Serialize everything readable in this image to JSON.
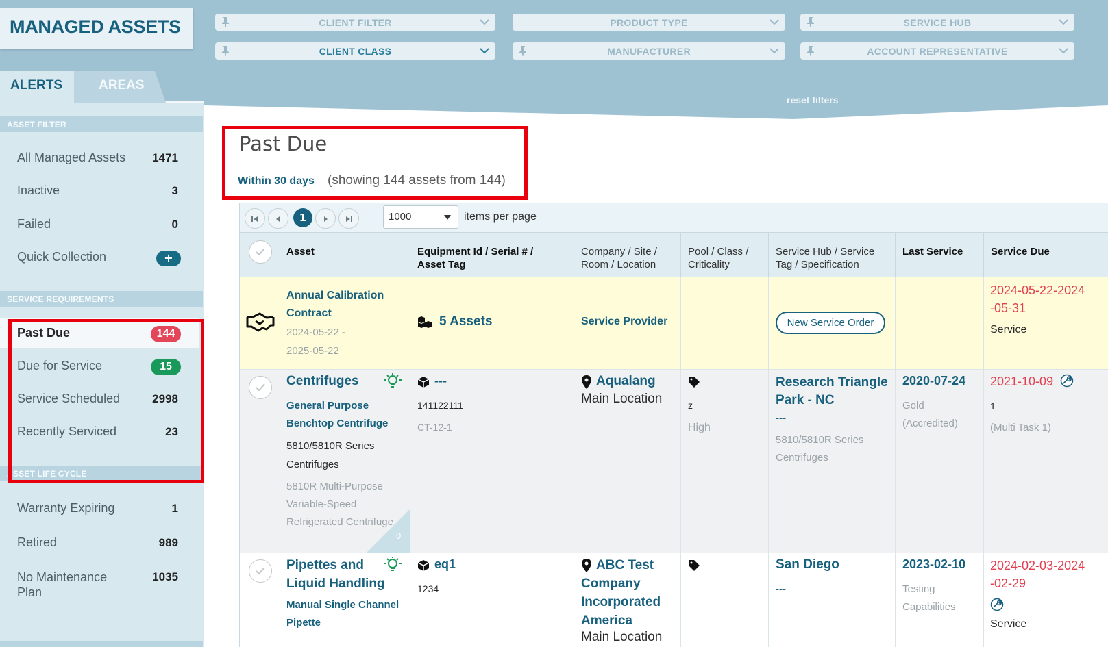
{
  "app": {
    "title": "MANAGED ASSETS"
  },
  "filters": [
    {
      "label": "CLIENT FILTER",
      "active": false
    },
    {
      "label": "PRODUCT TYPE",
      "active": false
    },
    {
      "label": "SERVICE HUB",
      "active": false
    },
    {
      "label": "CLIENT CLASS",
      "active": true
    },
    {
      "label": "MANUFACTURER",
      "active": false
    },
    {
      "label": "ACCOUNT REPRESENTATIVE",
      "active": false
    }
  ],
  "tabs": {
    "alerts": "ALERTS",
    "areas": "AREAS"
  },
  "reset_filters": "reset filters",
  "sidebar": {
    "asset_filter": {
      "heading": "ASSET FILTER",
      "items": [
        {
          "label": "All Managed Assets",
          "count": "1471"
        },
        {
          "label": "Inactive",
          "count": "3"
        },
        {
          "label": "Failed",
          "count": "0"
        },
        {
          "label": "Quick Collection",
          "count": "+"
        }
      ]
    },
    "service_requirements": {
      "heading": "SERVICE REQUIREMENTS",
      "items": [
        {
          "label": "Past Due",
          "count": "144"
        },
        {
          "label": "Due for Service",
          "count": "15"
        },
        {
          "label": "Service Scheduled",
          "count": "2998"
        },
        {
          "label": "Recently Serviced",
          "count": "23"
        }
      ]
    },
    "asset_life_cycle": {
      "heading": "ASSET LIFE CYCLE",
      "items": [
        {
          "label": "Warranty Expiring",
          "count": "1"
        },
        {
          "label": "Retired",
          "count": "989"
        },
        {
          "label": "No Maintenance Plan",
          "count": "1035"
        }
      ]
    }
  },
  "main": {
    "title": "Past Due",
    "within": "Within 30 days",
    "showing": "(showing 144 assets from 144)",
    "pager": {
      "current_page": "1",
      "per_page": "1000",
      "per_page_label": "items per page"
    },
    "columns": {
      "asset": "Asset",
      "equipment": "Equipment Id / Serial # / Asset Tag",
      "company": "Company / Site / Room / Location",
      "pool": "Pool / Class / Criticality",
      "hub": "Service Hub / Service Tag / Specification",
      "last_service": "Last Service",
      "service_due": "Service Due"
    },
    "rows": [
      {
        "asset_title": "Annual Calibration Contract",
        "asset_dates": "2024-05-22 - 2025-05-22",
        "equipment": "5 Assets",
        "company": "Service Provider",
        "action": "New Service Order",
        "service_due": "2024-05-22-2024-05-31",
        "service_due_type": "Service"
      },
      {
        "asset_title": "Centrifuges",
        "asset_sub": "General Purpose Benchtop Centrifuge",
        "asset_model": "5810/5810R Series Centrifuges",
        "asset_desc": "5810R Multi-Purpose Variable-Speed Refrigerated Centrifuge",
        "corner_count": "0",
        "equipment_id": "---",
        "serial": "141122111",
        "asset_tag": "CT-12-1",
        "company": "Aqualang",
        "location": "Main Location",
        "class": "z",
        "criticality": "High",
        "hub": "Research Triangle Park - NC",
        "service_tag": "---",
        "specification": "5810/5810R Series Centrifuges",
        "last_service": "2020-07-24",
        "last_service_note": "Gold (Accredited)",
        "service_due": "2021-10-09",
        "service_due_count": "1",
        "service_due_note": "(Multi Task 1)"
      },
      {
        "asset_title": "Pipettes and Liquid Handling",
        "asset_sub": "Manual Single Channel Pipette",
        "equipment_id": "eq1",
        "serial": "1234",
        "company": "ABC Test Company Incorporated America",
        "location": "Main Location",
        "hub": "San Diego",
        "service_tag": "---",
        "last_service": "2023-02-10",
        "last_service_note": "Testing Capabilities",
        "service_due": "2024-02-03-2024-02-29",
        "service_due_type": "Service"
      }
    ]
  }
}
